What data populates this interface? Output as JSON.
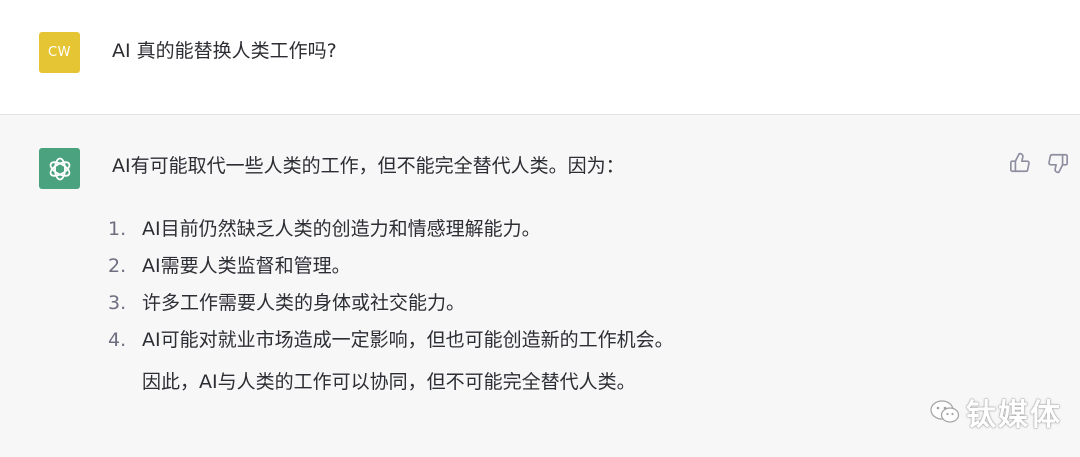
{
  "user": {
    "avatar_initials": "CW",
    "avatar_color": "#e6c534",
    "message": "AI 真的能替换人类工作吗?"
  },
  "assistant": {
    "avatar_icon": "openai-logo-icon",
    "avatar_color": "#4aa27e",
    "intro": "AI有可能取代一些人类的工作，但不能完全替代人类。因为：",
    "points": [
      {
        "number": "1.",
        "text": "AI目前仍然缺乏人类的创造力和情感理解能力。"
      },
      {
        "number": "2.",
        "text": "AI需要人类监督和管理。"
      },
      {
        "number": "3.",
        "text": "许多工作需要人类的身体或社交能力。"
      },
      {
        "number": "4.",
        "text": "AI可能对就业市场造成一定影响，但也可能创造新的工作机会。"
      }
    ],
    "conclusion": "因此，AI与人类的工作可以协同，但不可能完全替代人类。"
  },
  "feedback": {
    "thumbs_up_icon": "thumbs-up-icon",
    "thumbs_down_icon": "thumbs-down-icon"
  },
  "watermark": {
    "text": "钛媒体",
    "icon": "wechat-icon"
  }
}
